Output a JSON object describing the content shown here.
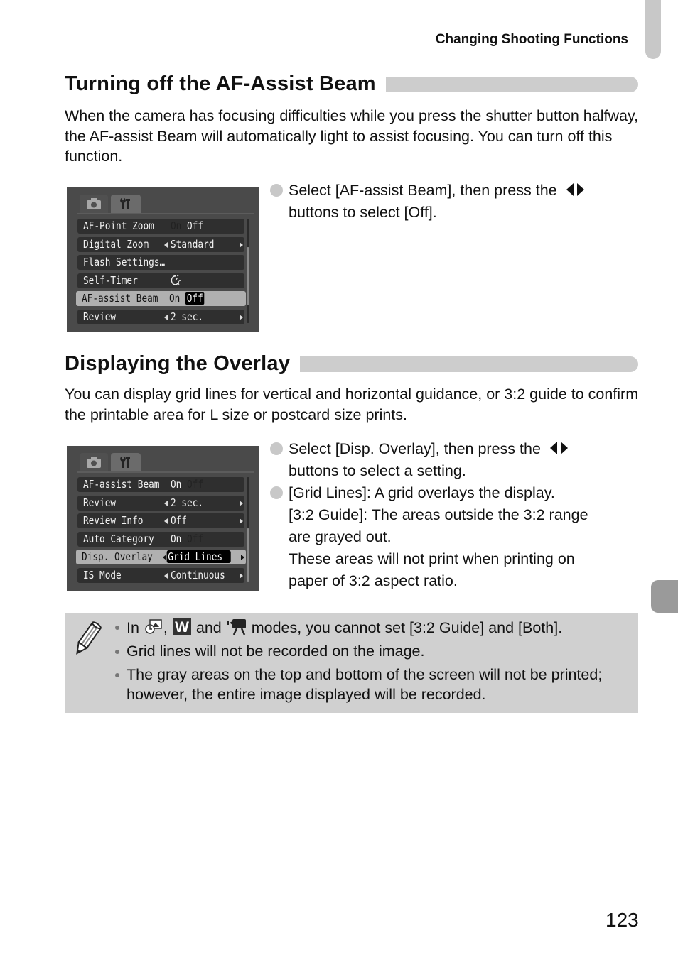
{
  "running_head": "Changing Shooting Functions",
  "page_number": "123",
  "section1": {
    "title": "Turning off the AF-Assist Beam",
    "intro": "When the camera has focusing difficulties while you press the shutter button halfway, the AF-assist Beam will automatically light to assist focusing. You can turn off this function.",
    "steps": [
      {
        "line1": "Select [AF-assist Beam], then press the",
        "line2": "buttons to select [Off]."
      }
    ],
    "lcd": {
      "tabs": [
        "camera-tab",
        "tools-tab"
      ],
      "rows": [
        {
          "label": "AF-Point Zoom",
          "on": "On",
          "off": "Off",
          "type": "onoff",
          "active": "off"
        },
        {
          "label": "Digital Zoom",
          "value": "Standard",
          "type": "arrows"
        },
        {
          "label": "Flash Settings…",
          "type": "plain"
        },
        {
          "label": "Self-Timer",
          "value": "self-timer-custom-icon",
          "type": "icon"
        },
        {
          "label": "AF-assist Beam",
          "on": "On",
          "off": "Off",
          "type": "onoff",
          "active": "off",
          "selected": true
        },
        {
          "label": "Review",
          "value": "2 sec.",
          "type": "arrows"
        }
      ]
    }
  },
  "section2": {
    "title": "Displaying the Overlay",
    "intro": "You can display grid lines for vertical and horizontal guidance, or 3:2 guide to confirm the printable area for L size or postcard size prints.",
    "steps": [
      {
        "line1": "Select [Disp. Overlay], then press the",
        "line2": "buttons to select a setting."
      },
      {
        "lines": [
          "[Grid Lines]: A grid overlays the display.",
          "[3:2 Guide]: The areas outside the 3:2 range",
          "are grayed out.",
          "These areas will not print when printing on",
          "paper of 3:2 aspect ratio."
        ]
      }
    ],
    "lcd": {
      "tabs": [
        "camera-tab",
        "tools-tab"
      ],
      "rows": [
        {
          "label": "AF-assist Beam",
          "on": "On",
          "off": "Off",
          "type": "onoff",
          "active": "on"
        },
        {
          "label": "Review",
          "value": "2 sec.",
          "type": "arrows"
        },
        {
          "label": "Review Info",
          "value": "Off",
          "type": "arrows"
        },
        {
          "label": "Auto Category",
          "on": "On",
          "off": "Off",
          "type": "onoff",
          "active": "on"
        },
        {
          "label": "Disp. Overlay",
          "value": "Grid Lines",
          "type": "arrows",
          "selected": true
        },
        {
          "label": "IS Mode",
          "value": "Continuous",
          "type": "arrows"
        }
      ]
    }
  },
  "note": {
    "items": [
      {
        "pre": "In",
        "sep1": ",",
        "and": "and",
        "post": "modes, you cannot set [3:2 Guide] and [Both].",
        "icons": [
          "stitch-assist-icon",
          "wide-w-icon",
          "movie-camera-icon"
        ]
      },
      {
        "text": "Grid lines will not be recorded on the image."
      },
      {
        "text": "The gray areas on the top and bottom of the screen will not be printed; however, the entire image displayed will be recorded."
      }
    ]
  }
}
